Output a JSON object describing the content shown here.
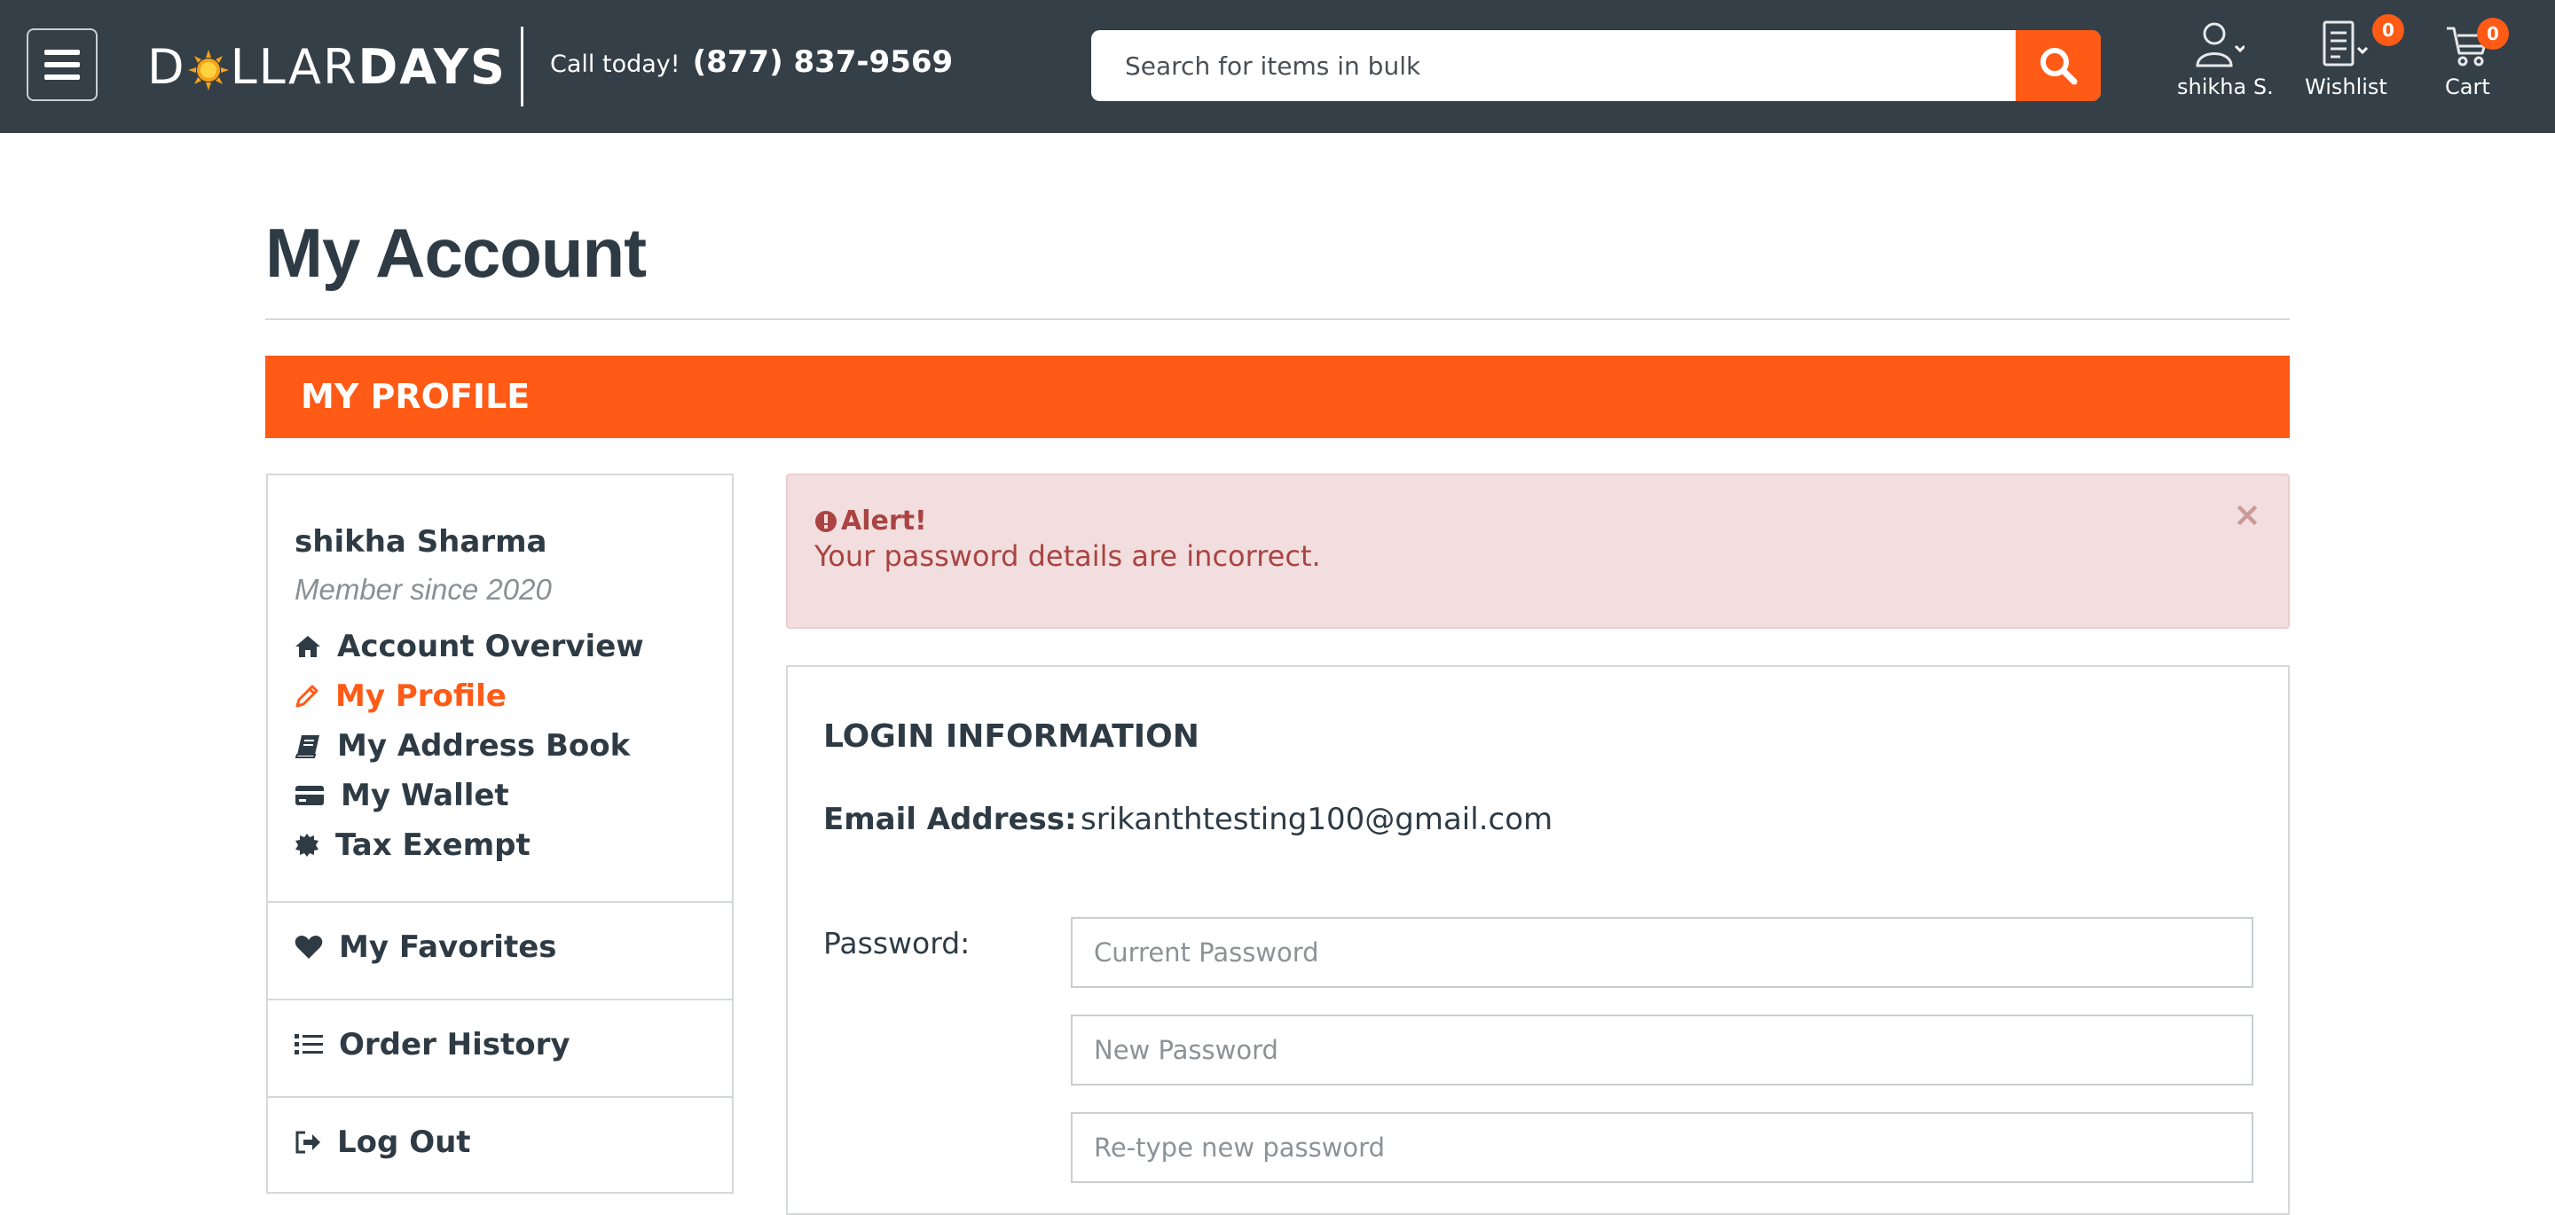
{
  "header": {
    "logo": {
      "part1": "D",
      "part2": "LLAR",
      "part3": "DAYS"
    },
    "call_label": "Call today!",
    "phone": "(877) 837-9569",
    "search_placeholder": "Search for items in bulk",
    "account_label": "shikha S.",
    "wishlist_label": "Wishlist",
    "wishlist_count": "0",
    "cart_label": "Cart",
    "cart_count": "0"
  },
  "page": {
    "title": "My Account",
    "section_banner": "MY PROFILE"
  },
  "sidebar": {
    "user_name": "shikha Sharma",
    "member_since": "Member since 2020",
    "links": [
      {
        "label": "Account Overview",
        "icon": "home-icon"
      },
      {
        "label": "My Profile",
        "icon": "pencil-icon",
        "active": true
      },
      {
        "label": "My Address Book",
        "icon": "book-icon"
      },
      {
        "label": "My Wallet",
        "icon": "credit-card-icon"
      },
      {
        "label": "Tax Exempt",
        "icon": "certificate-icon"
      }
    ],
    "favorites": "My Favorites",
    "order_history": "Order History",
    "logout": "Log Out"
  },
  "alert": {
    "title": "Alert!",
    "message": "Your password details are incorrect.",
    "close": "×"
  },
  "login_info": {
    "heading": "LOGIN INFORMATION",
    "email_label": "Email Address:",
    "email_value": "srikanthtesting100@gmail.com",
    "password_label": "Password:",
    "current_password_placeholder": "Current Password",
    "new_password_placeholder": "New Password",
    "retype_password_placeholder": "Re-type new password"
  },
  "colors": {
    "header_bg": "#343f47",
    "accent": "#ff5a16",
    "alert_bg": "#f2dede",
    "alert_text": "#a94442"
  }
}
